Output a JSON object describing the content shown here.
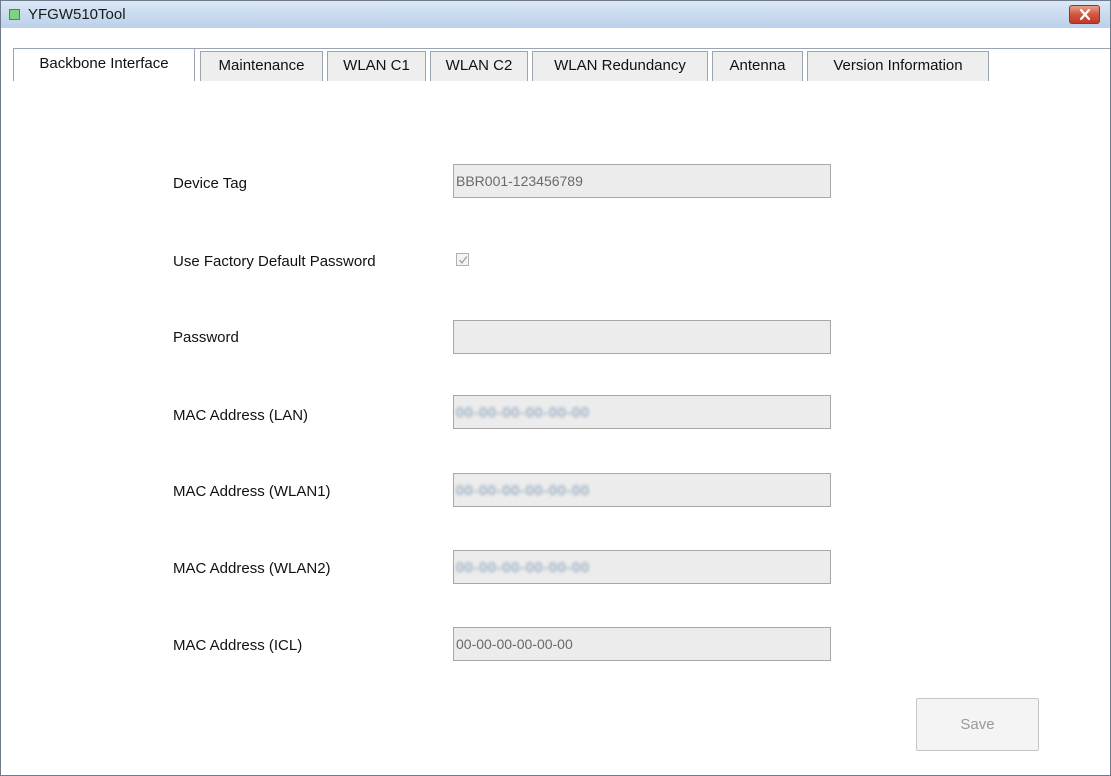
{
  "window": {
    "title": "YFGW510Tool"
  },
  "tabs": [
    {
      "label": "Backbone Interface",
      "active": true
    },
    {
      "label": "Maintenance",
      "active": false
    },
    {
      "label": "WLAN C1",
      "active": false
    },
    {
      "label": "WLAN C2",
      "active": false
    },
    {
      "label": "WLAN Redundancy",
      "active": false
    },
    {
      "label": "Antenna",
      "active": false
    },
    {
      "label": "Version Information",
      "active": false
    }
  ],
  "form": {
    "device_tag": {
      "label": "Device Tag",
      "value": "BBR001-123456789"
    },
    "use_factory_default": {
      "label": "Use Factory Default Password",
      "checked": true
    },
    "password": {
      "label": "Password",
      "value": ""
    },
    "mac_lan": {
      "label": "MAC Address (LAN)",
      "value": "00-00-00-00-00-00"
    },
    "mac_wlan1": {
      "label": "MAC Address (WLAN1)",
      "value": "00-00-00-00-00-00"
    },
    "mac_wlan2": {
      "label": "MAC Address (WLAN2)",
      "value": "00-00-00-00-00-00"
    },
    "mac_icl": {
      "label": "MAC Address (ICL)",
      "value": "00-00-00-00-00-00"
    }
  },
  "buttons": {
    "save": "Save"
  },
  "colors": {
    "titlebar": "#c9dbef",
    "close_button": "#c0392b",
    "field_background": "#ececec"
  }
}
